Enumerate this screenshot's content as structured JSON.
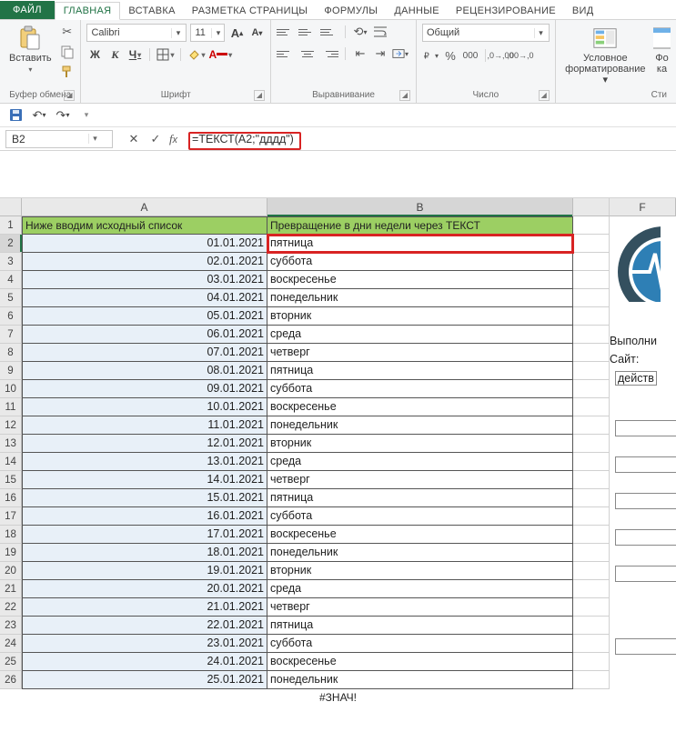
{
  "menu": {
    "file": "ФАЙЛ",
    "tabs": [
      "ГЛАВНАЯ",
      "ВСТАВКА",
      "РАЗМЕТКА СТРАНИЦЫ",
      "ФОРМУЛЫ",
      "ДАННЫЕ",
      "РЕЦЕНЗИРОВАНИЕ",
      "ВИД"
    ],
    "active_index": 0
  },
  "ribbon": {
    "clipboard": {
      "paste": "Вставить",
      "label": "Буфер обмена"
    },
    "font": {
      "name": "Calibri",
      "size": "11",
      "bold": "Ж",
      "italic": "К",
      "underline": "Ч",
      "label": "Шрифт"
    },
    "alignment": {
      "label": "Выравнивание"
    },
    "number": {
      "format": "Общий",
      "label": "Число"
    },
    "styles": {
      "condfmt_l1": "Условное",
      "condfmt_l2": "форматирование",
      "extra1": "Фо",
      "extra2": "ка",
      "label": "Сти"
    }
  },
  "namebox": "B2",
  "formula": "=ТЕКСТ(A2;\"дддд\")",
  "columns": [
    "A",
    "B",
    "F"
  ],
  "headers": {
    "A": "Ниже вводим исходный список",
    "B": "Превращение в дни недели через ТЕКСТ"
  },
  "rows": [
    {
      "n": 1
    },
    {
      "n": 2,
      "a": "01.01.2021",
      "b": "пятница",
      "sel": true
    },
    {
      "n": 3,
      "a": "02.01.2021",
      "b": "суббота"
    },
    {
      "n": 4,
      "a": "03.01.2021",
      "b": "воскресенье"
    },
    {
      "n": 5,
      "a": "04.01.2021",
      "b": "понедельник"
    },
    {
      "n": 6,
      "a": "05.01.2021",
      "b": "вторник"
    },
    {
      "n": 7,
      "a": "06.01.2021",
      "b": "среда"
    },
    {
      "n": 8,
      "a": "07.01.2021",
      "b": "четверг"
    },
    {
      "n": 9,
      "a": "08.01.2021",
      "b": "пятница"
    },
    {
      "n": 10,
      "a": "09.01.2021",
      "b": "суббота"
    },
    {
      "n": 11,
      "a": "10.01.2021",
      "b": "воскресенье"
    },
    {
      "n": 12,
      "a": "11.01.2021",
      "b": "понедельник"
    },
    {
      "n": 13,
      "a": "12.01.2021",
      "b": "вторник"
    },
    {
      "n": 14,
      "a": "13.01.2021",
      "b": "среда"
    },
    {
      "n": 15,
      "a": "14.01.2021",
      "b": "четверг"
    },
    {
      "n": 16,
      "a": "15.01.2021",
      "b": "пятница"
    },
    {
      "n": 17,
      "a": "16.01.2021",
      "b": "суббота"
    },
    {
      "n": 18,
      "a": "17.01.2021",
      "b": "воскресенье"
    },
    {
      "n": 19,
      "a": "18.01.2021",
      "b": "понедельник"
    },
    {
      "n": 20,
      "a": "19.01.2021",
      "b": "вторник"
    },
    {
      "n": 21,
      "a": "20.01.2021",
      "b": "среда"
    },
    {
      "n": 22,
      "a": "21.01.2021",
      "b": "четверг"
    },
    {
      "n": 23,
      "a": "22.01.2021",
      "b": "пятница"
    },
    {
      "n": 24,
      "a": "23.01.2021",
      "b": "суббота"
    },
    {
      "n": 25,
      "a": "24.01.2021",
      "b": "воскресенье"
    },
    {
      "n": 26,
      "a": "25.01.2021",
      "b": "понедельник"
    }
  ],
  "right": {
    "line1": "Выполни",
    "line2": "Сайт:",
    "line3": "действ"
  },
  "error_row": "#ЗНАЧ!"
}
